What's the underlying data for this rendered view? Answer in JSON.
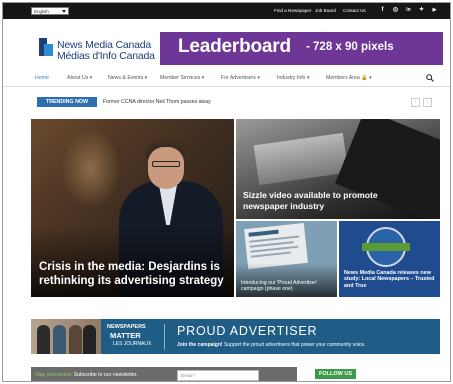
{
  "topbar": {
    "language": "English",
    "links": [
      "Find a Newspaper",
      "Job Board",
      "Contact Us"
    ],
    "social": [
      {
        "icon": "facebook-icon",
        "glyph": "f"
      },
      {
        "icon": "instagram-icon",
        "glyph": "◎"
      },
      {
        "icon": "linkedin-icon",
        "glyph": "in"
      },
      {
        "icon": "twitter-icon",
        "glyph": "✦"
      },
      {
        "icon": "youtube-icon",
        "glyph": "▶"
      }
    ]
  },
  "header": {
    "logo_line1": "News Media Canada",
    "logo_line2": "Médias d'Info Canada",
    "leaderboard_big": "Leaderboard",
    "leaderboard_small": "- 728 x 90 pixels",
    "leaderboard_color": "#6e3797"
  },
  "nav": {
    "items": [
      "Home",
      "About Us ▾",
      "News & Events ▾",
      "Member Services ▾",
      "For Advertisers ▾",
      "Industry Info ▾",
      "Members Area 🔒 ▾"
    ],
    "active_color": "#3b8bc9"
  },
  "trending": {
    "label": "TRENDING NOW",
    "headline": "Former CCNA director Neil Thom passes away",
    "prev": "‹",
    "next": "›"
  },
  "stories": {
    "main": "Crisis in the media: Desjardins is rethinking its advertising strategy",
    "top_right": "Sizzle video available to promote newspaper industry",
    "bottom_left": "Introducing our 'Proud Advertiser' campaign (phase one)",
    "bottom_right": "News Media Canada releases new study: Local Newspapers – Trusted and True"
  },
  "proud_banner": {
    "line1": "NEWSPAPERS",
    "line2": "MATTER",
    "line3": "LES JOURNAUX",
    "title": "PROUD ADVERTISER",
    "sub_bold": "Join the campaign!",
    "sub_rest": " Support the proud advertisers that power your community voice.",
    "bg_color": "#1f5d86"
  },
  "newsletter": {
    "green": "Stay connected.",
    "rest": " Subscribe to our newsletter.",
    "email_placeholder": "Email *"
  },
  "follow": {
    "label": "FOLLOW US"
  }
}
